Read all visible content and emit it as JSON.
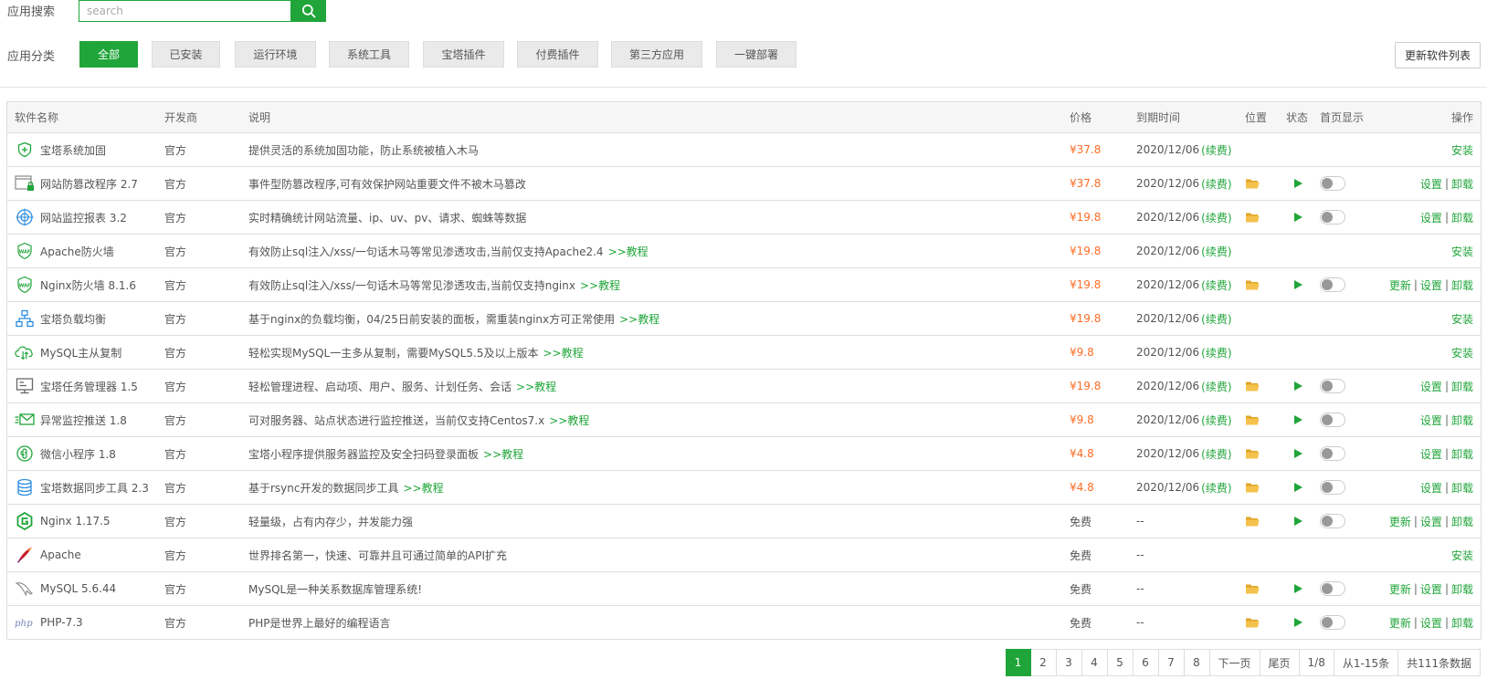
{
  "search": {
    "label": "应用搜索",
    "placeholder": "search"
  },
  "category": {
    "label": "应用分类",
    "items": [
      "全部",
      "已安装",
      "运行环境",
      "系统工具",
      "宝塔插件",
      "付费插件",
      "第三方应用",
      "一键部署"
    ],
    "refresh_label": "更新软件列表"
  },
  "table": {
    "headers": [
      "软件名称",
      "开发商",
      "说明",
      "价格",
      "到期时间",
      "位置",
      "状态",
      "首页显示",
      "操作"
    ],
    "rows": [
      {
        "icon": "shield-plus-icon",
        "name": "宝塔系统加固",
        "dev": "官方",
        "desc": "提供灵活的系统加固功能，防止系统被植入木马",
        "tutorial": "",
        "price": "¥37.8",
        "paid": true,
        "exp": "2020/12/06",
        "renew": "(续费)",
        "installed": false,
        "ops": [
          "安装"
        ]
      },
      {
        "icon": "browser-lock-icon",
        "name": "网站防篡改程序 2.7",
        "dev": "官方",
        "desc": "事件型防篡改程序,可有效保护网站重要文件不被木马篡改",
        "tutorial": "",
        "price": "¥37.8",
        "paid": true,
        "exp": "2020/12/06",
        "renew": "(续费)",
        "installed": true,
        "ops": [
          "设置",
          "卸载"
        ]
      },
      {
        "icon": "target-icon",
        "name": "网站监控报表 3.2",
        "dev": "官方",
        "desc": "实时精确统计网站流量、ip、uv、pv、请求、蜘蛛等数据",
        "tutorial": "",
        "price": "¥19.8",
        "paid": true,
        "exp": "2020/12/06",
        "renew": "(续费)",
        "installed": true,
        "ops": [
          "设置",
          "卸载"
        ]
      },
      {
        "icon": "waf-shield-icon",
        "name": "Apache防火墙",
        "dev": "官方",
        "desc": "有效防止sql注入/xss/一句话木马等常见渗透攻击,当前仅支持Apache2.4",
        "tutorial": ">>教程",
        "price": "¥19.8",
        "paid": true,
        "exp": "2020/12/06",
        "renew": "(续费)",
        "installed": false,
        "ops": [
          "安装"
        ]
      },
      {
        "icon": "waf-shield-icon",
        "name": "Nginx防火墙 8.1.6",
        "dev": "官方",
        "desc": "有效防止sql注入/xss/一句话木马等常见渗透攻击,当前仅支持nginx",
        "tutorial": ">>教程",
        "price": "¥19.8",
        "paid": true,
        "exp": "2020/12/06",
        "renew": "(续费)",
        "installed": true,
        "ops": [
          "更新",
          "设置",
          "卸载"
        ]
      },
      {
        "icon": "network-icon",
        "name": "宝塔负载均衡",
        "dev": "官方",
        "desc": "基于nginx的负载均衡，04/25日前安装的面板，需重装nginx方可正常使用",
        "tutorial": ">>教程",
        "price": "¥19.8",
        "paid": true,
        "exp": "2020/12/06",
        "renew": "(续费)",
        "installed": false,
        "ops": [
          "安装"
        ]
      },
      {
        "icon": "cloud-sync-icon",
        "name": "MySQL主从复制",
        "dev": "官方",
        "desc": "轻松实现MySQL一主多从复制，需要MySQL5.5及以上版本",
        "tutorial": ">>教程",
        "price": "¥9.8",
        "paid": true,
        "exp": "2020/12/06",
        "renew": "(续费)",
        "installed": false,
        "ops": [
          "安装"
        ]
      },
      {
        "icon": "monitor-icon",
        "name": "宝塔任务管理器 1.5",
        "dev": "官方",
        "desc": "轻松管理进程、启动项、用户、服务、计划任务、会话",
        "tutorial": ">>教程",
        "price": "¥19.8",
        "paid": true,
        "exp": "2020/12/06",
        "renew": "(续费)",
        "installed": true,
        "ops": [
          "设置",
          "卸载"
        ]
      },
      {
        "icon": "mail-send-icon",
        "name": "异常监控推送 1.8",
        "dev": "官方",
        "desc": "可对服务器、站点状态进行监控推送，当前仅支持Centos7.x",
        "tutorial": ">>教程",
        "price": "¥9.8",
        "paid": true,
        "exp": "2020/12/06",
        "renew": "(续费)",
        "installed": true,
        "ops": [
          "设置",
          "卸载"
        ]
      },
      {
        "icon": "wechat-mini-icon",
        "name": "微信小程序 1.8",
        "dev": "官方",
        "desc": "宝塔小程序提供服务器监控及安全扫码登录面板",
        "tutorial": ">>教程",
        "price": "¥4.8",
        "paid": true,
        "exp": "2020/12/06",
        "renew": "(续费)",
        "installed": true,
        "ops": [
          "设置",
          "卸载"
        ]
      },
      {
        "icon": "database-sync-icon",
        "name": "宝塔数据同步工具 2.3",
        "dev": "官方",
        "desc": "基于rsync开发的数据同步工具",
        "tutorial": ">>教程",
        "price": "¥4.8",
        "paid": true,
        "exp": "2020/12/06",
        "renew": "(续费)",
        "installed": true,
        "ops": [
          "设置",
          "卸载"
        ]
      },
      {
        "icon": "nginx-logo-icon",
        "name": "Nginx 1.17.5",
        "dev": "官方",
        "desc": "轻量级，占有内存少，并发能力强",
        "tutorial": "",
        "price": "免费",
        "paid": false,
        "exp": "--",
        "renew": "",
        "installed": true,
        "ops": [
          "更新",
          "设置",
          "卸载"
        ]
      },
      {
        "icon": "apache-feather-icon",
        "name": "Apache",
        "dev": "官方",
        "desc": "世界排名第一，快速、可靠并且可通过简单的API扩充",
        "tutorial": "",
        "price": "免费",
        "paid": false,
        "exp": "--",
        "renew": "",
        "installed": false,
        "ops": [
          "安装"
        ]
      },
      {
        "icon": "mysql-dolphin-icon",
        "name": "MySQL 5.6.44",
        "dev": "官方",
        "desc": "MySQL是一种关系数据库管理系统!",
        "tutorial": "",
        "price": "免费",
        "paid": false,
        "exp": "--",
        "renew": "",
        "installed": true,
        "ops": [
          "更新",
          "设置",
          "卸载"
        ]
      },
      {
        "icon": "php-logo-icon",
        "name": "PHP-7.3",
        "dev": "官方",
        "desc": "PHP是世界上最好的编程语言",
        "tutorial": "",
        "price": "免费",
        "paid": false,
        "exp": "--",
        "renew": "",
        "installed": true,
        "ops": [
          "更新",
          "设置",
          "卸载"
        ]
      }
    ]
  },
  "pagination": {
    "pages": [
      "1",
      "2",
      "3",
      "4",
      "5",
      "6",
      "7",
      "8"
    ],
    "current": "1",
    "next": "下一页",
    "last": "尾页",
    "page_info": "1/8",
    "range": "从1-15条",
    "total": "共111条数据"
  },
  "colors": {
    "accent": "#20a53a",
    "price": "#fc6d26",
    "folder": "#f0b840"
  }
}
